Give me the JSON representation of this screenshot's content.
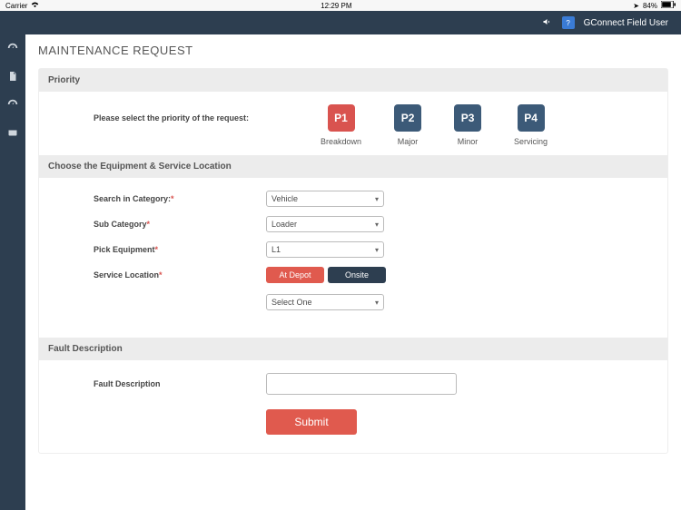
{
  "status": {
    "carrier": "Carrier",
    "time": "12:29 PM",
    "battery": "84%"
  },
  "header": {
    "user": "GConnect Field User"
  },
  "sidebar": {
    "items": [
      {
        "icon": "dashboard"
      },
      {
        "icon": "document"
      },
      {
        "icon": "dashboard2"
      },
      {
        "icon": "calendar"
      }
    ]
  },
  "page": {
    "title": "MAINTENANCE REQUEST"
  },
  "priority": {
    "section_title": "Priority",
    "prompt": "Please select the priority of the request:",
    "items": [
      {
        "code": "P1",
        "label": "Breakdown",
        "selected": true
      },
      {
        "code": "P2",
        "label": "Major",
        "selected": false
      },
      {
        "code": "P3",
        "label": "Minor",
        "selected": false
      },
      {
        "code": "P4",
        "label": "Servicing",
        "selected": false
      }
    ]
  },
  "equipment": {
    "section_title": "Choose the Equipment & Service Location",
    "category_label": "Search in Category:",
    "category_value": "Vehicle",
    "subcategory_label": "Sub Category",
    "subcategory_value": "Loader",
    "pick_label": "Pick Equipment",
    "pick_value": "L1",
    "location_label": "Service Location",
    "loc_depot": "At Depot",
    "loc_onsite": "Onsite",
    "select_one": "Select One"
  },
  "fault": {
    "section_title": "Fault Description",
    "label": "Fault Description",
    "value": ""
  },
  "submit_label": "Submit"
}
